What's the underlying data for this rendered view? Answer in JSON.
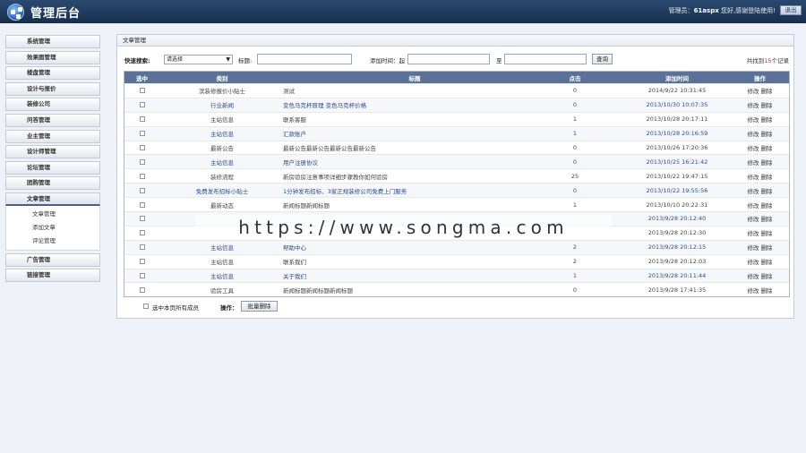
{
  "header": {
    "title": "管理后台",
    "user_prefix": "管理员：",
    "username": "61aspx",
    "user_suffix": " 您好,感谢登陆使用!",
    "logout_label": "退出"
  },
  "sidebar": {
    "items": [
      {
        "label": "系统管理"
      },
      {
        "label": "效果图管理"
      },
      {
        "label": "楼盘管理"
      },
      {
        "label": "设计与报价"
      },
      {
        "label": "装修公司"
      },
      {
        "label": "问答管理"
      },
      {
        "label": "业主管理"
      },
      {
        "label": "设计师管理"
      },
      {
        "label": "论坛管理"
      },
      {
        "label": "团购管理"
      },
      {
        "label": "文章管理"
      }
    ],
    "submenu": [
      {
        "label": "文章管理"
      },
      {
        "label": "添加文章"
      },
      {
        "label": "评论管理"
      }
    ],
    "items_after": [
      {
        "label": "广告管理"
      },
      {
        "label": "链接管理"
      }
    ]
  },
  "panel": {
    "title": "文章管理",
    "filter": {
      "quick_search_label": "快速搜索:",
      "select_value": "请选择",
      "title_label": "标题:",
      "time_label": "添加时间：起",
      "to_label": "至",
      "query_label": "查询",
      "total_prefix": "共找到",
      "total_count": "15",
      "total_suffix": "个记录"
    },
    "columns": {
      "select": "选中",
      "category": "类别",
      "title": "标题",
      "clicks": "点击",
      "time": "添加时间",
      "ops": "操作"
    },
    "rows": [
      {
        "category": "滨装修报价小贴士",
        "title": "测试",
        "clicks": "0",
        "time": "2014/9/22 10:31:45",
        "cat_link": false,
        "title_link": false
      },
      {
        "category": "行业新闻",
        "title": "变色马克杯原理 变色马克杯价格",
        "clicks": "0",
        "time": "2013/10/30 10:07:35",
        "cat_link": true,
        "title_link": true
      },
      {
        "category": "主站信息",
        "title": "联系客服",
        "clicks": "1",
        "time": "2013/10/28 20:17:11",
        "cat_link": false,
        "title_link": false
      },
      {
        "category": "主站信息",
        "title": "汇款账户",
        "clicks": "1",
        "time": "2013/10/28 20:16:59",
        "cat_link": true,
        "title_link": true
      },
      {
        "category": "最新公告",
        "title": "最新公告最新公告最新公告最新公告",
        "clicks": "0",
        "time": "2013/10/26 17:20:36",
        "cat_link": false,
        "title_link": false
      },
      {
        "category": "主站信息",
        "title": "用户注册协议",
        "clicks": "0",
        "time": "2013/10/25 16:21:42",
        "cat_link": true,
        "title_link": true
      },
      {
        "category": "装修流程",
        "title": "新房验房注意事项详细步骤教你如何验房",
        "clicks": "25",
        "time": "2013/10/22 19:47:15",
        "cat_link": false,
        "title_link": false
      },
      {
        "category": "免费发布招标小贴士",
        "title": "1分钟发布招标、3家正规装修公司免费上门服务",
        "clicks": "0",
        "time": "2013/10/22 19:55:56",
        "cat_link": true,
        "title_link": true
      },
      {
        "category": "最新动态",
        "title": "新闻标题新闻标题",
        "clicks": "1",
        "time": "2013/10/10 20:22:31",
        "cat_link": false,
        "title_link": false
      },
      {
        "category": "",
        "title": "",
        "clicks": "",
        "time": "2013/9/28 20:12:40",
        "cat_link": true,
        "title_link": true
      },
      {
        "category": "",
        "title": "",
        "clicks": "",
        "time": "2013/9/28 20:12:30",
        "cat_link": false,
        "title_link": false
      },
      {
        "category": "主站信息",
        "title": "帮助中心",
        "clicks": "2",
        "time": "2013/9/28 20:12:15",
        "cat_link": true,
        "title_link": true
      },
      {
        "category": "主站信息",
        "title": "联系我们",
        "clicks": "2",
        "time": "2013/9/28 20:12:03",
        "cat_link": false,
        "title_link": false
      },
      {
        "category": "主站信息",
        "title": "关于我们",
        "clicks": "1",
        "time": "2013/9/28 20:11:44",
        "cat_link": true,
        "title_link": true
      },
      {
        "category": "验房工具",
        "title": "新闻标题新闻标题新闻标题",
        "clicks": "0",
        "time": "2013/9/28 17:41:35",
        "cat_link": false,
        "title_link": false
      }
    ],
    "ops": {
      "edit": "修改",
      "delete": "删除"
    },
    "footer": {
      "select_all_label": "选中本页所有成员",
      "op_label": "操作：",
      "batch_delete_label": "批量删除"
    }
  },
  "watermark": "https://www.songma.com"
}
